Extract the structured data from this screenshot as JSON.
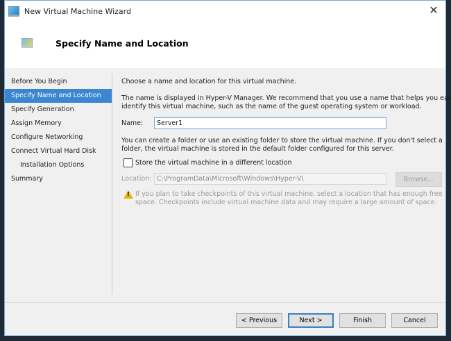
{
  "window": {
    "title": "New Virtual Machine Wizard"
  },
  "header": {
    "title": "Specify Name and Location"
  },
  "nav": {
    "items": [
      {
        "label": "Before You Begin"
      },
      {
        "label": "Specify Name and Location"
      },
      {
        "label": "Specify Generation"
      },
      {
        "label": "Assign Memory"
      },
      {
        "label": "Configure Networking"
      },
      {
        "label": "Connect Virtual Hard Disk"
      },
      {
        "label": "Installation Options"
      },
      {
        "label": "Summary"
      }
    ]
  },
  "main": {
    "intro": "Choose a name and location for this virtual machine.",
    "desc1": "The name is displayed in Hyper-V Manager. We recommend that you use a name that helps you easily",
    "desc2": "identify this virtual machine, such as the name of the guest operating system or workload.",
    "name_label": "Name:",
    "name_value": "Server1",
    "folder1": "You can create a folder or use an existing folder to store the virtual machine. If you don't select a",
    "folder2": "folder, the virtual machine is stored in the default folder configured for this server.",
    "checkbox_label": "Store the virtual machine in a different location",
    "location_label": "Location:",
    "location_value": "C:\\ProgramData\\Microsoft\\Windows\\Hyper-V\\",
    "browse": "Browse...",
    "warn1": "If you plan to take checkpoints of this virtual machine, select a location that has enough free",
    "warn2": "space. Checkpoints include virtual machine data and may require a large amount of space."
  },
  "footer": {
    "previous": "< Previous",
    "next": "Next >",
    "finish": "Finish",
    "cancel": "Cancel"
  }
}
